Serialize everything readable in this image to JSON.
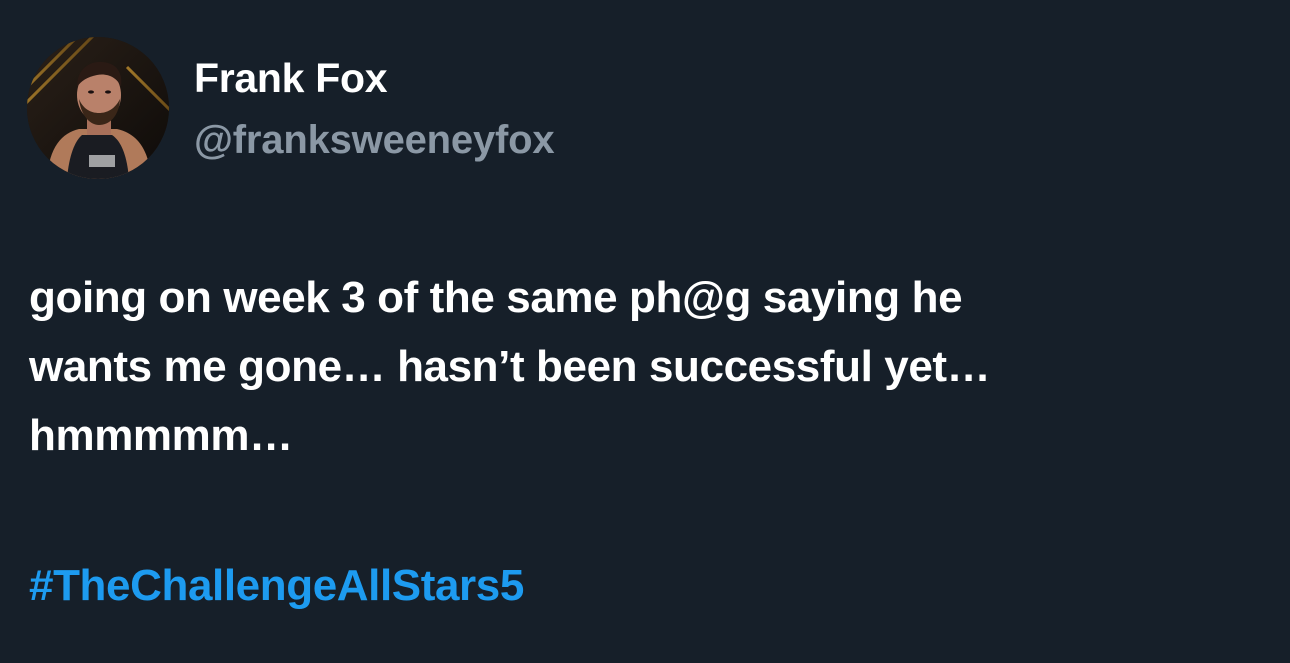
{
  "tweet": {
    "author": {
      "display_name": "Frank Fox",
      "handle": "@franksweeneyfox",
      "avatar_icon": "profile-photo"
    },
    "text_lines": [
      "going on week 3 of the same ph@g saying he",
      "wants me gone… hasn’t been successful yet…",
      "hmmmmm…"
    ],
    "hashtag": "#TheChallengeAllStars5"
  },
  "colors": {
    "background": "#161f29",
    "primary_text": "#ffffff",
    "secondary_text": "#8b98a5",
    "link": "#1d9bf0"
  }
}
